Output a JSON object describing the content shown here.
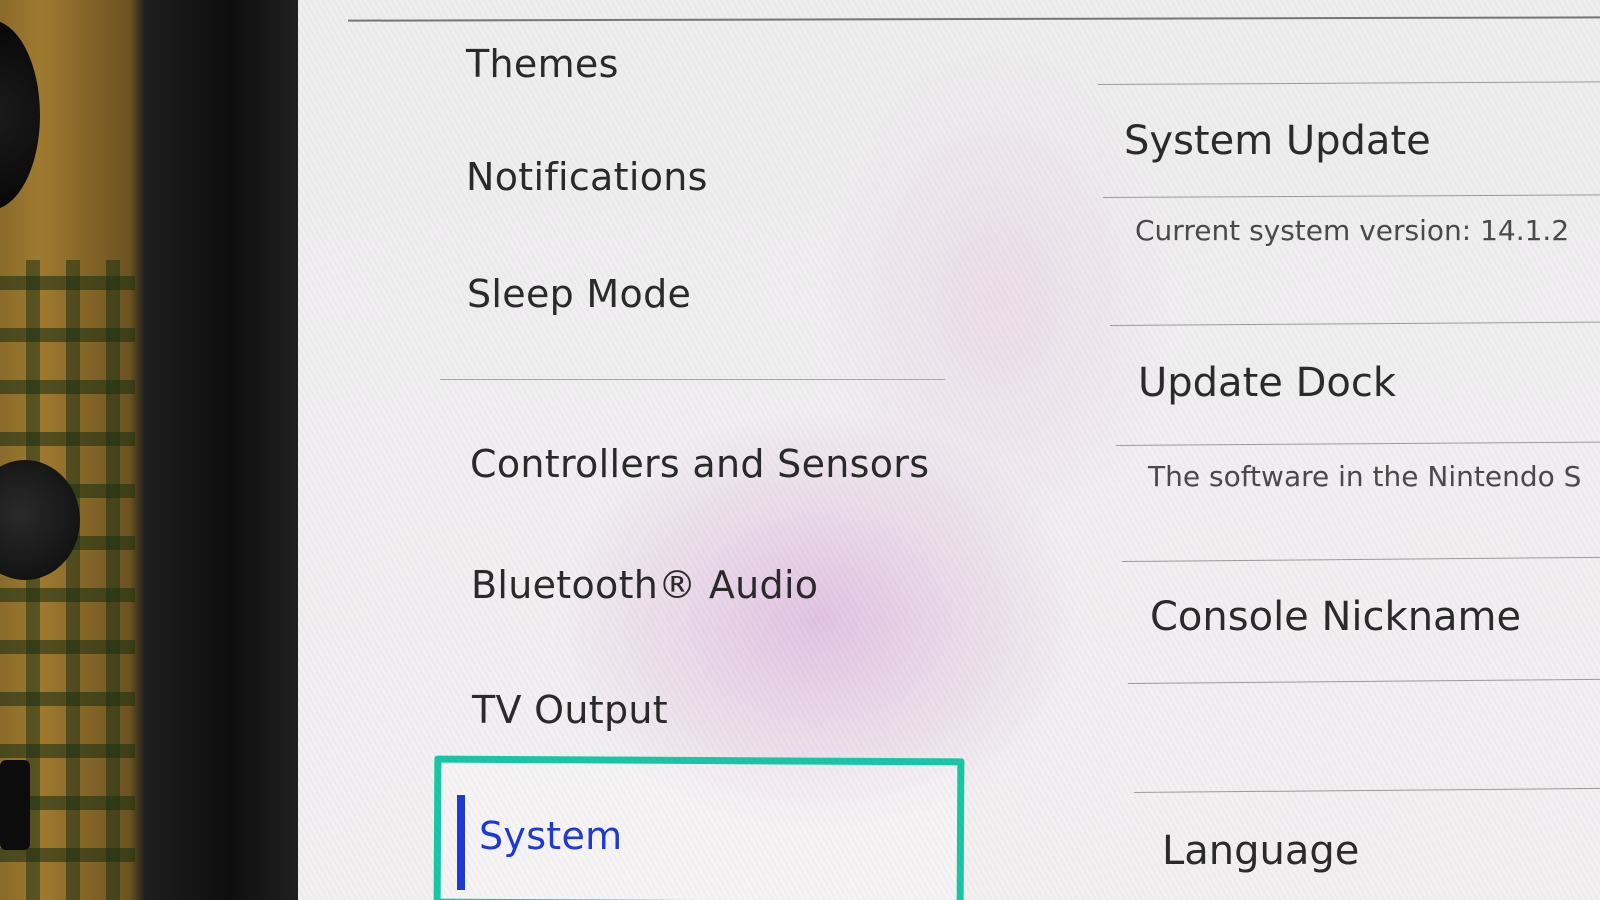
{
  "nav": {
    "items": [
      {
        "label": "Themes"
      },
      {
        "label": "Notifications"
      },
      {
        "label": "Sleep Mode"
      },
      {
        "label": "Controllers and Sensors"
      },
      {
        "label": "Bluetooth® Audio"
      },
      {
        "label": "TV Output"
      },
      {
        "label": "System"
      }
    ],
    "selected": "System"
  },
  "system_panel": {
    "system_update": {
      "label": "System Update",
      "description": "Current system version: 14.1.2"
    },
    "update_dock": {
      "label": "Update Dock",
      "description": "The software in the Nintendo S"
    },
    "console_nickname": {
      "label": "Console Nickname"
    },
    "language": {
      "label": "Language"
    }
  },
  "colors": {
    "selection_border": "#19c7a6",
    "selected_text": "#1f3ad0"
  }
}
